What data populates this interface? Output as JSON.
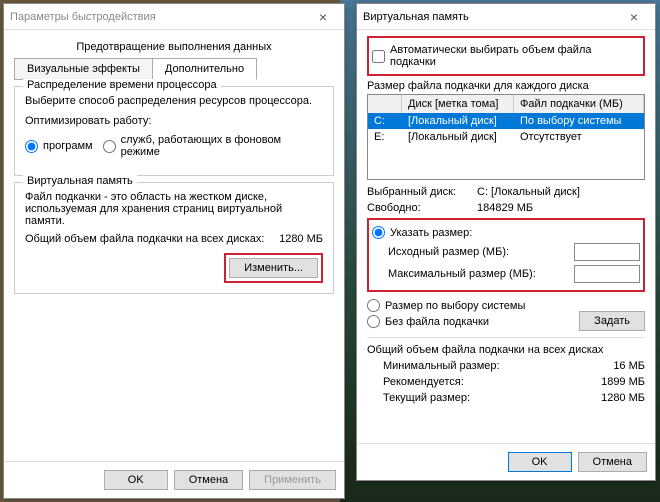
{
  "perf": {
    "title": "Параметры быстродействия",
    "dep_header": "Предотвращение выполнения данных",
    "tab_visual": "Визуальные эффекты",
    "tab_advanced": "Дополнительно",
    "cpu_header": "Распределение времени процессора",
    "cpu_desc": "Выберите способ распределения ресурсов процессора.",
    "cpu_opt": "Оптимизировать работу:",
    "cpu_r1": "программ",
    "cpu_r2": "служб, работающих в фоновом режиме",
    "vm_header": "Виртуальная память",
    "vm_desc": "Файл подкачки - это область на жестком диске, используемая для хранения страниц виртуальной памяти.",
    "vm_total_lbl": "Общий объем файла подкачки на всех дисках:",
    "vm_total_val": "1280 МБ",
    "btn_change": "Изменить...",
    "ok": "OK",
    "cancel": "Отмена",
    "apply": "Применить"
  },
  "vm": {
    "title": "Виртуальная память",
    "auto": "Автоматически выбирать объем файла подкачки",
    "per_drive": "Размер файла подкачки для каждого диска",
    "col_drive": "Диск [метка тома]",
    "col_file": "Файл подкачки (МБ)",
    "drives": [
      {
        "d": "C:",
        "label": "[Локальный диск]",
        "pf": "По выбору системы"
      },
      {
        "d": "E:",
        "label": "[Локальный диск]",
        "pf": "Отсутствует"
      }
    ],
    "sel_drive_lbl": "Выбранный диск:",
    "sel_drive_val": "C: [Локальный диск]",
    "free_lbl": "Свободно:",
    "free_val": "184829 МБ",
    "r_custom": "Указать размер:",
    "initial": "Исходный размер (МБ):",
    "max": "Максимальный размер (МБ):",
    "r_system": "Размер по выбору системы",
    "r_none": "Без файла подкачки",
    "btn_set": "Задать",
    "total_hdr": "Общий объем файла подкачки на всех дисках",
    "min_lbl": "Минимальный размер:",
    "min_val": "16 МБ",
    "rec_lbl": "Рекомендуется:",
    "rec_val": "1899 МБ",
    "cur_lbl": "Текущий размер:",
    "cur_val": "1280 МБ",
    "ok": "OK",
    "cancel": "Отмена"
  }
}
